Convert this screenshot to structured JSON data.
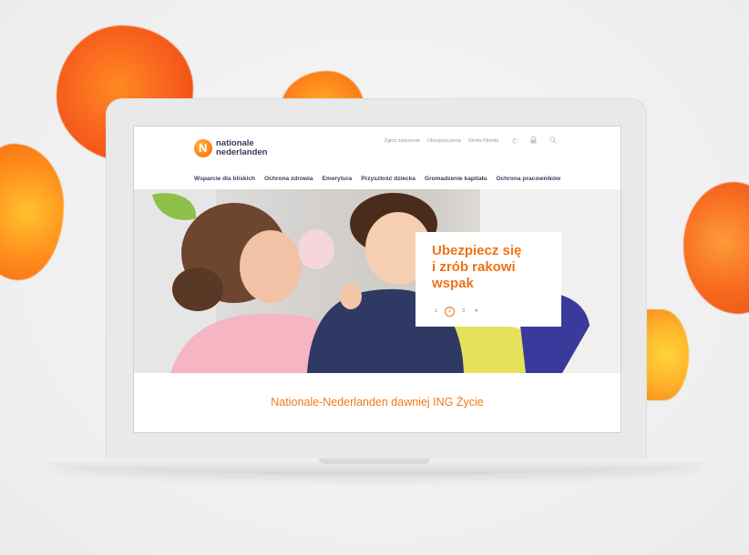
{
  "colors": {
    "brand_orange": "#ee7218",
    "navy_text": "#3d3d5c",
    "utility_gray": "#9a9a9a",
    "background": "#f0f0f0"
  },
  "logo": {
    "line1": "nationale",
    "line2": "nederlanden"
  },
  "utility_links": [
    "Zgłoś zdarzenie",
    "Ubezpieczenia",
    "Strefa Klienta"
  ],
  "utility_icons": [
    "phone-icon",
    "lock-icon",
    "search-icon"
  ],
  "nav": [
    "Wsparcie dla bliskich",
    "Ochrona zdrowia",
    "Emerytura",
    "Przyszłość dziecka",
    "Gromadzenie kapitału",
    "Ochrona pracowników"
  ],
  "hero": {
    "headline": [
      "Ubezpiecz się",
      "i zrób rakowi",
      "wspak"
    ],
    "pagination": [
      "1",
      "2",
      "3",
      "4"
    ],
    "active_page": "2"
  },
  "tagline": "Nationale-Nederlanden dawniej ING Życie"
}
